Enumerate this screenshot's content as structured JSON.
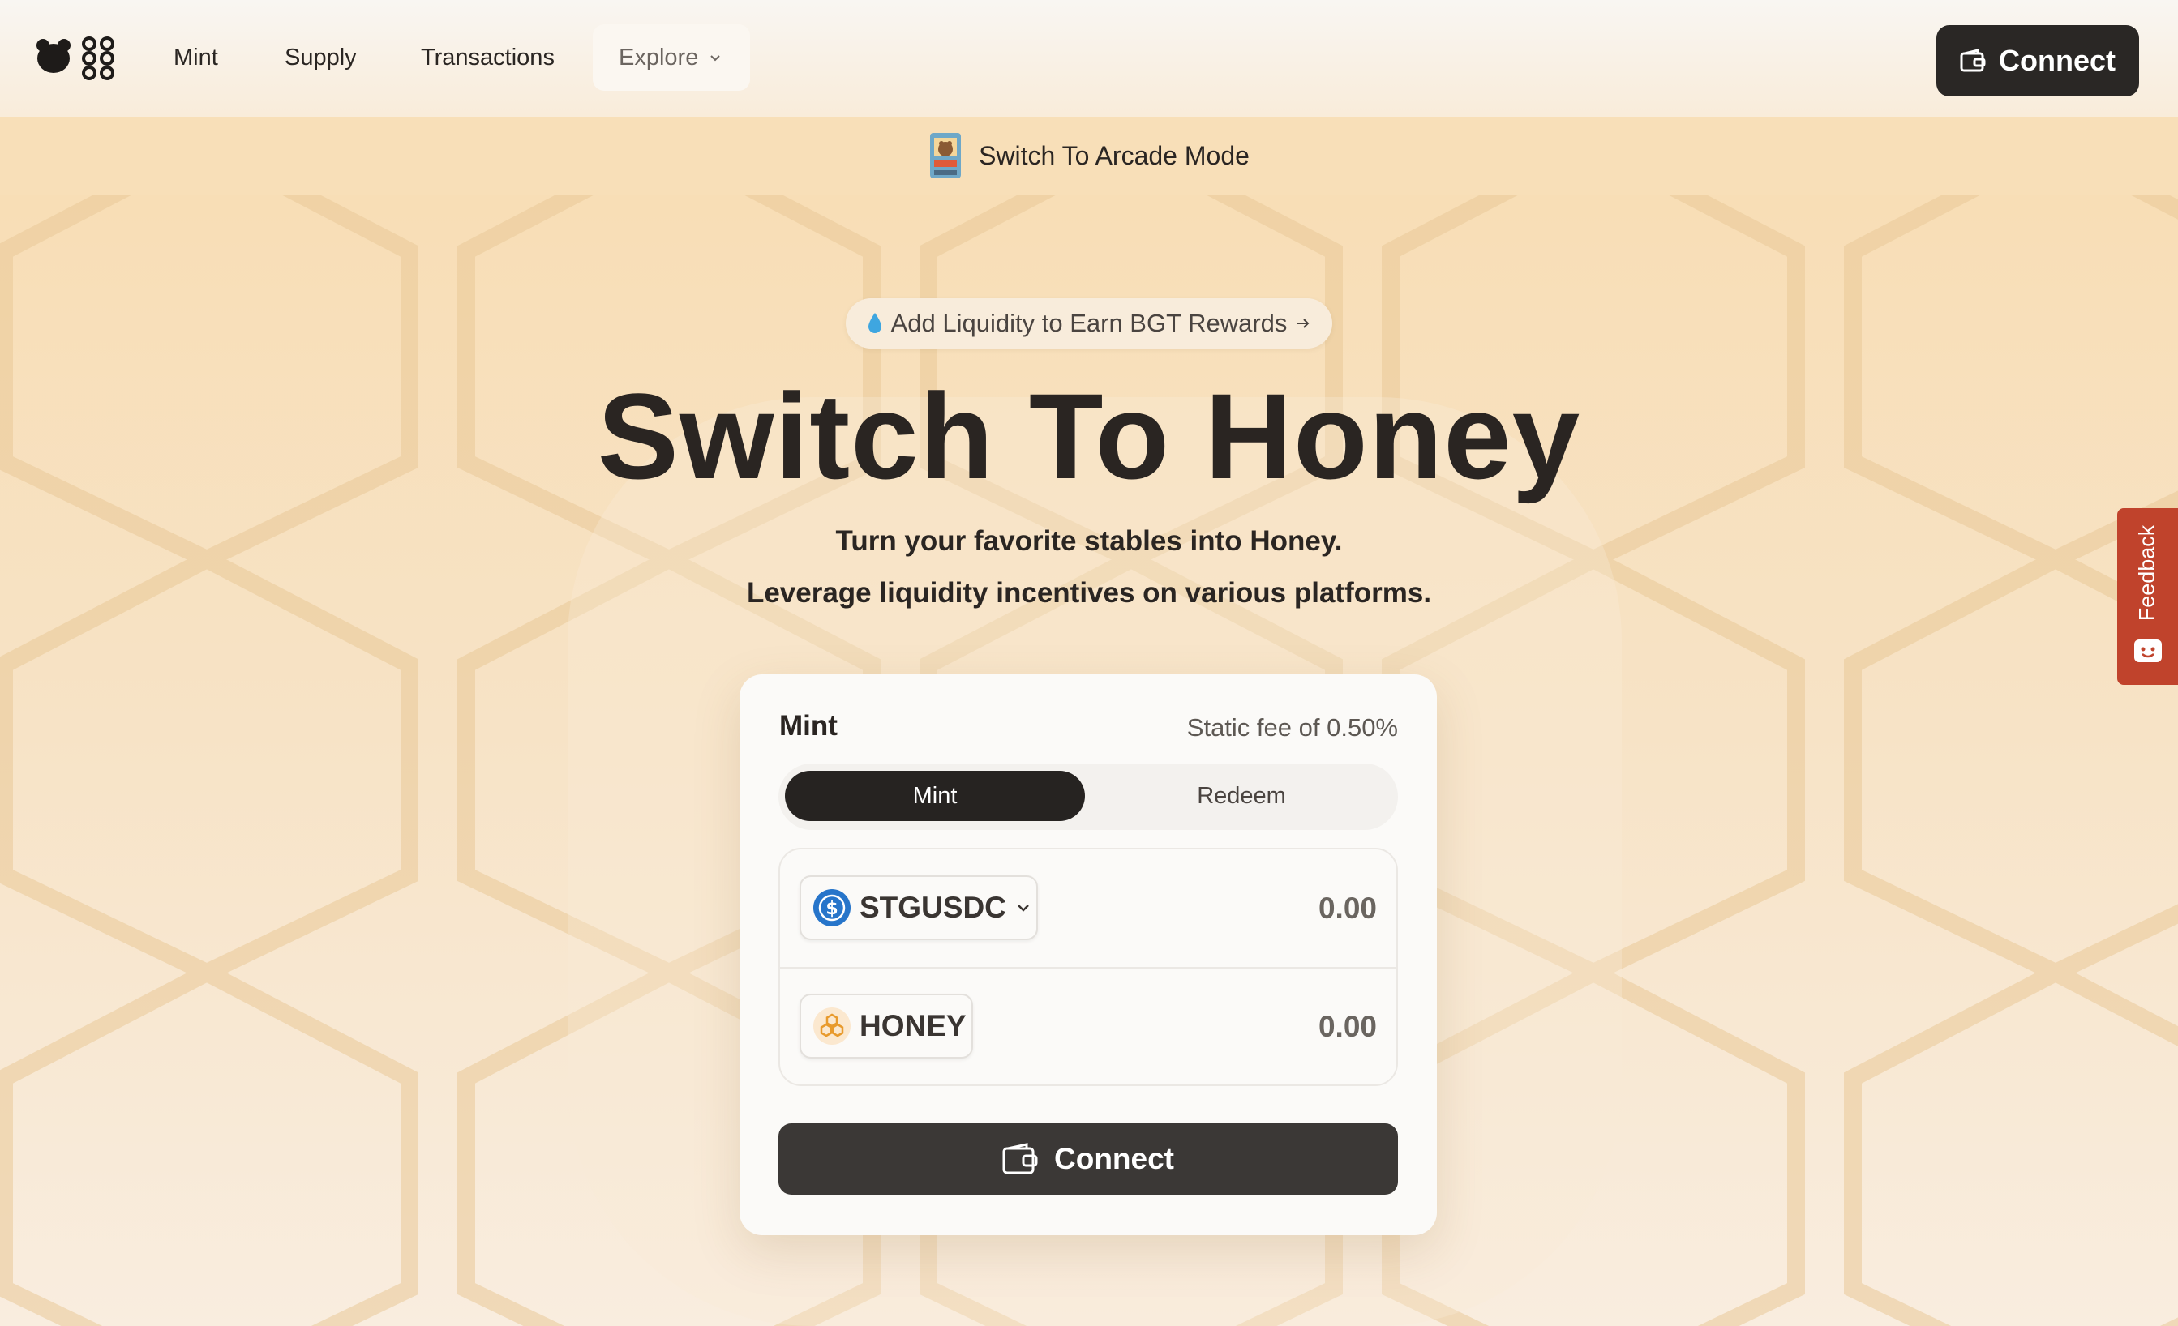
{
  "nav": {
    "links": [
      "Mint",
      "Supply",
      "Transactions"
    ],
    "explore_label": "Explore",
    "connect_label": "Connect"
  },
  "banner": {
    "arcade_label": "Switch To Arcade Mode"
  },
  "hero": {
    "pill_label": "Add Liquidity to Earn BGT Rewards",
    "title": "Switch To Honey",
    "subtitle_line1": "Turn your favorite stables into Honey.",
    "subtitle_line2": "Leverage liquidity incentives on various platforms."
  },
  "card": {
    "title": "Mint",
    "fee_text": "Static fee of 0.50%",
    "tabs": {
      "mint": "Mint",
      "redeem": "Redeem"
    },
    "input_token": {
      "symbol": "STGUSDC",
      "amount": "0.00"
    },
    "output_token": {
      "symbol": "HONEY",
      "amount": "0.00"
    },
    "connect_label": "Connect"
  },
  "feedback": {
    "label": "Feedback"
  },
  "colors": {
    "dark_button": "#2a2725",
    "feedback": "#c0432c",
    "usdc_blue": "#2775ca",
    "honey_orange": "#e89a2c"
  }
}
